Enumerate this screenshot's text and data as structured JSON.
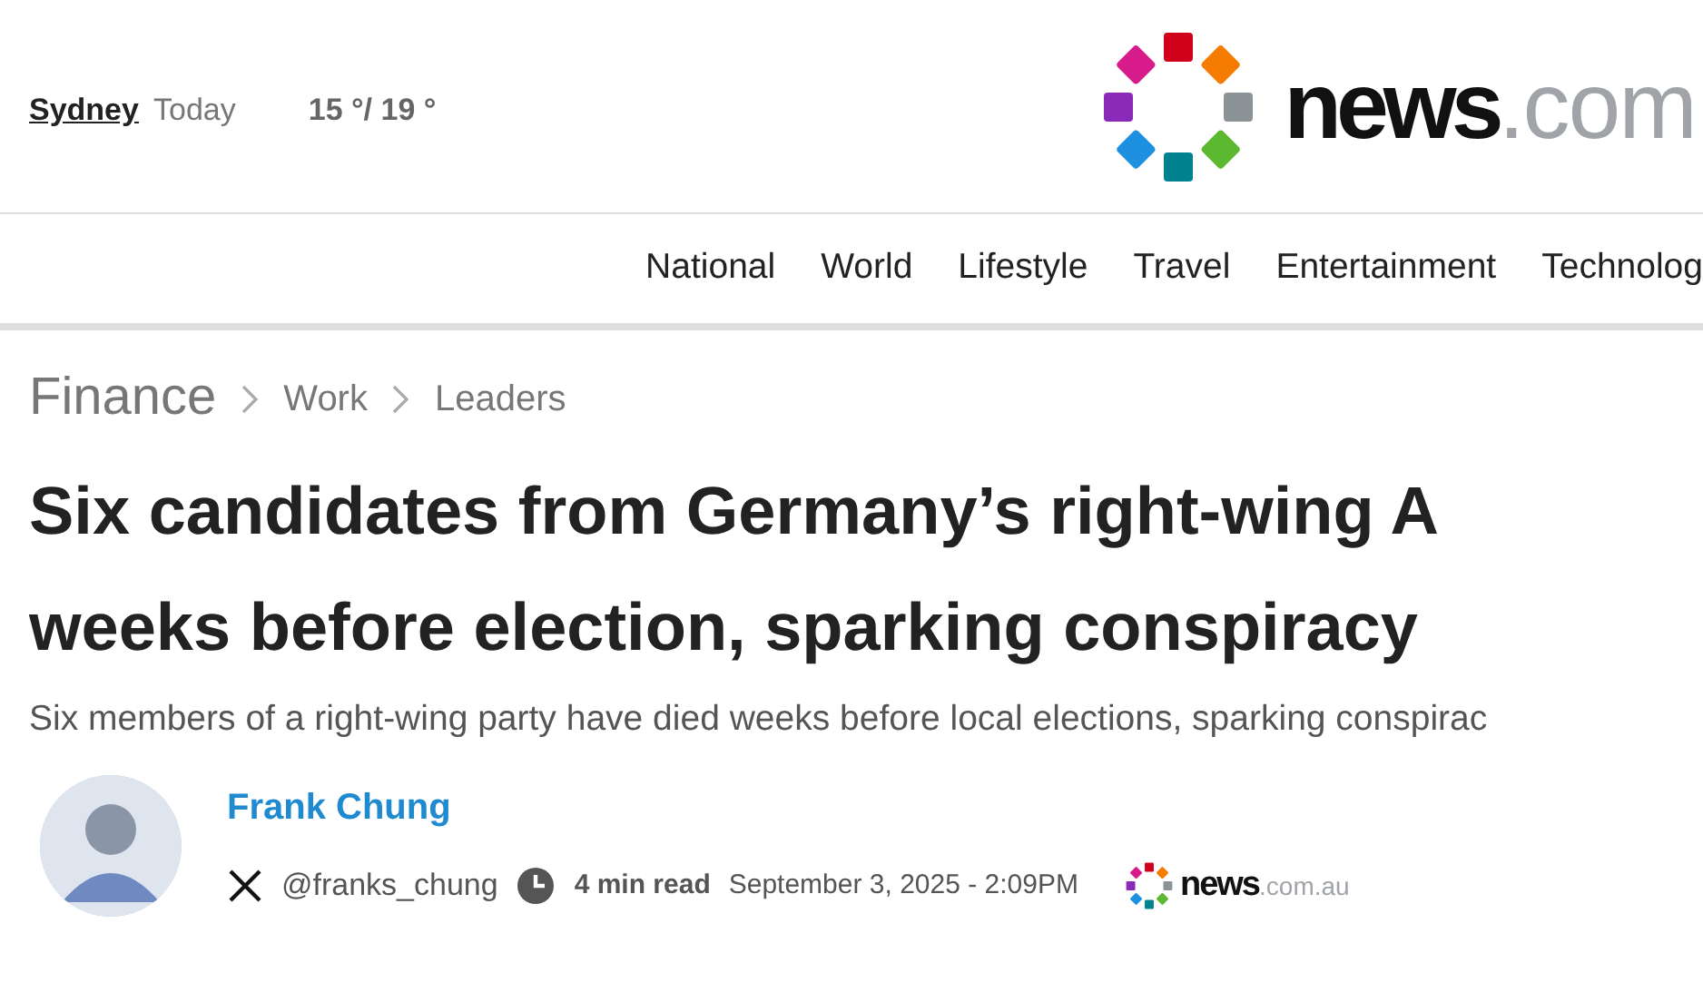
{
  "header": {
    "location": "Sydney",
    "day": "Today",
    "temperature": "15 °/ 19 °",
    "logo": {
      "brand": "news",
      "suffix": ".com"
    }
  },
  "nav": [
    {
      "label": "National"
    },
    {
      "label": "World"
    },
    {
      "label": "Lifestyle"
    },
    {
      "label": "Travel"
    },
    {
      "label": "Entertainment"
    },
    {
      "label": "Technolog"
    }
  ],
  "breadcrumb": [
    {
      "label": "Finance"
    },
    {
      "label": "Work"
    },
    {
      "label": "Leaders"
    }
  ],
  "headline": [
    "Six candidates from Germany’s right-wing A",
    "weeks before election, sparking conspiracy"
  ],
  "standfirst": "Six members of a right-wing party have died weeks before local elections, sparking conspirac",
  "author": {
    "name": "Frank Chung",
    "handle": "@franks_chung",
    "read_time": "4 min read",
    "published": "September 3, 2025 - 2:09PM",
    "source_logo": {
      "brand": "news",
      "suffix": ".com.au"
    }
  }
}
